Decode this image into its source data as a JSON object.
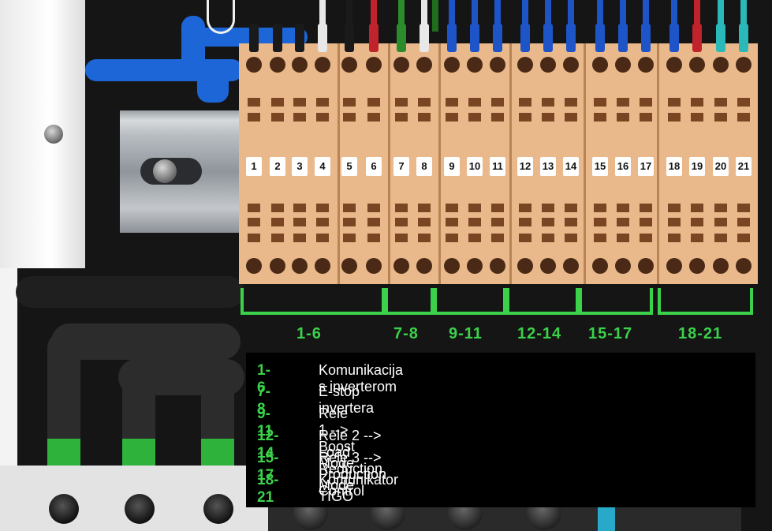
{
  "terminal_numbers": [
    "1",
    "2",
    "3",
    "4",
    "5",
    "6",
    "7",
    "8",
    "9",
    "10",
    "11",
    "12",
    "13",
    "14",
    "15",
    "16",
    "17",
    "18",
    "19",
    "20",
    "21"
  ],
  "groups": [
    {
      "range": "1-6"
    },
    {
      "range": "7-8"
    },
    {
      "range": "9-11"
    },
    {
      "range": "12-14"
    },
    {
      "range": "15-17"
    },
    {
      "range": "18-21"
    }
  ],
  "legend": [
    {
      "key": "1-6",
      "text": "Komunikacija s inverterom"
    },
    {
      "key": "7-8",
      "text": "E-stop invertera"
    },
    {
      "key": "9-11",
      "text": "Rele 1 --> Boost Mode"
    },
    {
      "key": "12-14",
      "text": "Rele 2 --> Load Reduction Mode"
    },
    {
      "key": "15-17",
      "text": "Rele 3 --> Production Control"
    },
    {
      "key": "18-21",
      "text": "Komunikator TIGO"
    }
  ],
  "colors": {
    "accent_green": "#3bd14a",
    "terminal_beige": "#e9b98b",
    "wire_blue": "#1d66d8",
    "wire_red": "#c0232b",
    "wire_teal": "#2ab8b8",
    "wire_green": "#2c8c2c"
  }
}
